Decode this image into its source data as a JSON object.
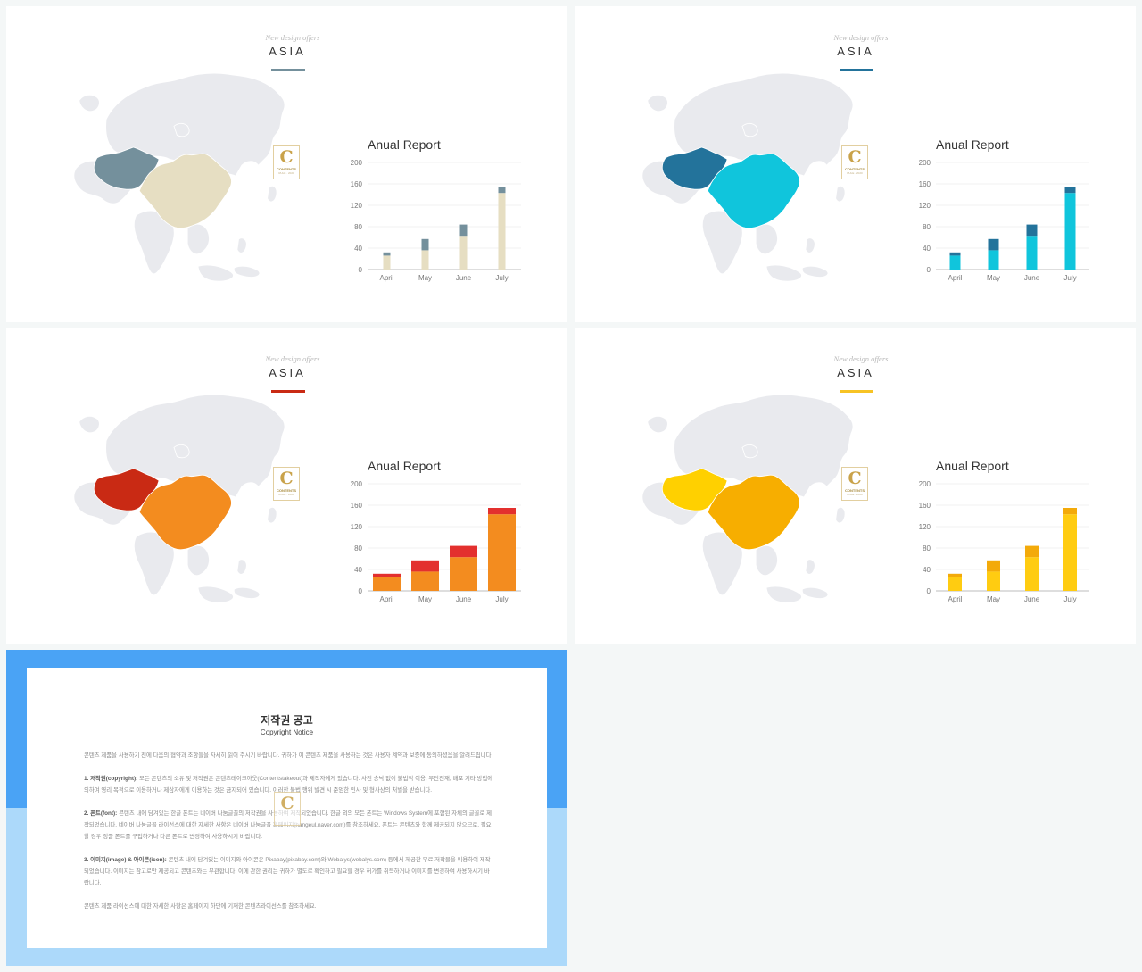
{
  "slides": [
    {
      "tagline": "New design offers",
      "title": "ASIA",
      "accent": "#74909c",
      "highlight_a": "#74909c",
      "highlight_b": "#e6dec2",
      "bar_bottom": "#e6dec2",
      "bar_top": "#74909c",
      "bar_width": 8,
      "logo_letter": "C",
      "logo_text": "CONTENTS",
      "logo_sub": "RULE · 2020"
    },
    {
      "tagline": "New design offers",
      "title": "ASIA",
      "accent": "#23739b",
      "highlight_a": "#23739b",
      "highlight_b": "#10c5dc",
      "bar_bottom": "#10c5dc",
      "bar_top": "#23739b",
      "bar_width": 12,
      "logo_letter": "C",
      "logo_text": "CONTENTS",
      "logo_sub": "RULE · 2020"
    },
    {
      "tagline": "New design offers",
      "title": "ASIA",
      "accent": "#c92a14",
      "highlight_a": "#c92a14",
      "highlight_b": "#f38c1f",
      "bar_bottom": "#f38c1f",
      "bar_top": "#e3302e",
      "bar_width": 31,
      "logo_letter": "C",
      "logo_text": "CONTENTS",
      "logo_sub": "RULE · 2020"
    },
    {
      "tagline": "New design offers",
      "title": "ASIA",
      "accent": "#f7c324",
      "highlight_a": "#ffd000",
      "highlight_b": "#f7ae00",
      "bar_bottom": "#ffcc11",
      "bar_top": "#f3aa0a",
      "bar_width": 15,
      "logo_letter": "C",
      "logo_text": "CONTENTS",
      "logo_sub": "RULE · 2020"
    }
  ],
  "chart_data": {
    "type": "bar",
    "stacked": true,
    "title": "Anual Report",
    "categories": [
      "April",
      "May",
      "June",
      "July"
    ],
    "series": [
      {
        "values": [
          26,
          36,
          63,
          143
        ]
      },
      {
        "values": [
          6,
          21,
          21,
          12
        ]
      }
    ],
    "ylim": [
      0,
      200
    ],
    "yticks": [
      0,
      40,
      80,
      120,
      160,
      200
    ],
    "grid": true,
    "xlabel": "",
    "ylabel": ""
  },
  "notice": {
    "title": "저작권 공고",
    "subtitle": "Copyright Notice",
    "intro": "콘텐츠 제품을 사용하기 전에 다음의 협약과 조항들을 자세히 읽어 주시기 바랍니다. 귀하가 이 콘텐츠 제품을 사용하는 것은 사용자 계약과 보증에 동의하셨음을 알려드립니다.",
    "p1_head": "1. 저작권(copyright):",
    "p1_body": " 모든 콘텐츠의 소유 및 저작권은 콘텐츠테이크아웃(Contentstakeout)과 제작자에게 있습니다. 사전 승낙 없이 불법적 이용, 무단전재, 배포 기타 방법에 의하여 영리 목적으로 이용하거나 제삼자에게 이용하는 것은 금지되어 있습니다. 이러한 불법 행위 발견 시 준엄한 민사 및 형사상의 처벌을 받습니다.",
    "p2_head": "2. 폰트(font):",
    "p2_body": " 콘텐츠 내에 담겨있는 한글 폰트는 네이버 나눔글꼴의 저작권을 사용하여 제작되었습니다. 한글 외의 모든 폰트는 Windows System에 포함된 자체의 글꼴로 제작되었습니다. 네이버 나눔글꼴 라이선스에 대한 자세한 사항은 네이버 나눔글꼴 홈페이지(hangeul.naver.com)를 참조하세요. 폰트는 콘텐츠와 함께 제공되지 않으므로, 필요할 경우 정품 폰트를 구입하거나 다른 폰트로 변경하여 사용하시기 바랍니다.",
    "p3_head": "3. 이미지(image) & 아이콘(icon):",
    "p3_body": " 콘텐츠 내에 담겨있는 이미지와 아이콘은 Pixabay(pixabay.com)와 Webalys(webalys.com) 등에서 제공한 무료 저작물을 이용하여 제작되었습니다. 이미지는 참고로만 제공되고 콘텐츠와는 무관합니다. 이에 관한 권리는 귀하가 별도로 확인하고 필요할 경우 허가를 취득하거나 이미지를 변경하여 사용하시기 바랍니다.",
    "outro": "콘텐츠 제품 라이선스에 대한 자세한 사항은 홈페이지 하단에 기재한 콘텐츠라이선스를 참조하세요.",
    "logo_letter": "C"
  }
}
